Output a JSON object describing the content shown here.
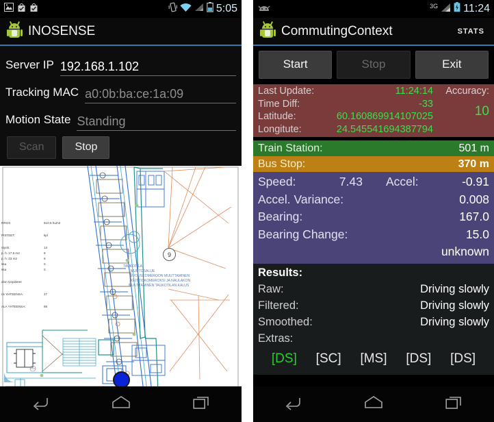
{
  "left_phone": {
    "statusbar": {
      "icons": [
        "image-icon",
        "download-complete-icon",
        "download-complete-icon"
      ],
      "right_icons": [
        "vibrate-icon",
        "wifi-icon",
        "signal-icon",
        "battery-icon"
      ],
      "clock": "5:05"
    },
    "actionbar": {
      "app_icon": "android-robot-icon",
      "title": "INOSENSE"
    },
    "form": {
      "fields": [
        {
          "label": "Server IP",
          "value": "192.168.1.102",
          "is_placeholder": false
        },
        {
          "label": "Tracking MAC",
          "value": "a0:0b:ba:ce:1a:09",
          "is_placeholder": true
        },
        {
          "label": "Motion State",
          "value": "Standing",
          "is_placeholder": true
        }
      ],
      "buttons": [
        {
          "label": "Scan",
          "enabled": false
        },
        {
          "label": "Stop",
          "enabled": true
        }
      ]
    },
    "map": {
      "name": "floor-plan",
      "marker": "current-position-blip",
      "callout_number": "9",
      "annotation_lines": [
        "TAUKOTILA",
        "MUUTOSALUE",
        "SIVOUSKOMEROON MUUTTAMINEN",
        "KEITTIOKOMEROKSI JA NAULAKON",
        "MUUTTAMINEN TAUKOTILAN KALUS"
      ],
      "legend": [
        {
          "key": "RROS",
          "value": "610.5 hum2"
        },
        {
          "key": "PISTEET:",
          "value": "kpl"
        },
        {
          "key": "otyoh.",
          "value": "13"
        },
        {
          "key": "p. h. 17,5 m2",
          "value": "8"
        },
        {
          "key": "p. h. 23 m2",
          "value": "6"
        },
        {
          "key": "ssa",
          "value": "0"
        },
        {
          "key": "ssa",
          "value": "0"
        },
        {
          "key": "alon tyopisteet",
          "value": ""
        },
        {
          "key": "ns  YHTEENSA:",
          "value": "27"
        },
        {
          "key": "ALA YHTEENSA:",
          "value": "88"
        }
      ]
    },
    "navbar": {
      "items": [
        "back-icon",
        "home-icon",
        "recents-icon"
      ]
    }
  },
  "right_phone": {
    "statusbar": {
      "left_icons": [
        "android-face-icon"
      ],
      "network": "3G",
      "right_icons": [
        "signal-icon",
        "battery-charging-icon"
      ],
      "clock": "11:24"
    },
    "actionbar": {
      "app_icon": "android-robot-icon",
      "title": "CommutingContext",
      "action_label": "STATS"
    },
    "controls": [
      {
        "label": "Start",
        "enabled": true
      },
      {
        "label": "Stop",
        "enabled": false
      },
      {
        "label": "Exit",
        "enabled": true
      }
    ],
    "gps_panel": {
      "bg_color": "#7a3b3b",
      "rows": [
        {
          "key": "Last Update:",
          "value": "11:24:14"
        },
        {
          "key": "Time Diff:",
          "value": "-33"
        },
        {
          "key": "Latitude:",
          "value": "60.160869914107025"
        },
        {
          "key": "Longitute:",
          "value": "24.545541694387794"
        }
      ],
      "accuracy_label": "Accuracy:",
      "accuracy_value": "10"
    },
    "transit": [
      {
        "key": "Train Station:",
        "value": "501 m",
        "bg_color": "#2b7a2b"
      },
      {
        "key": "Bus Stop:",
        "value": "370 m",
        "bg_color": "#bd8014"
      }
    ],
    "motion_panel": {
      "bg_color": "#4a4478",
      "speed_key": "Speed:",
      "speed_value": "7.43",
      "accel_key": "Accel:",
      "accel_value": "-0.91",
      "rows": [
        {
          "key": "Accel. Variance:",
          "value": "0.008"
        },
        {
          "key": "Bearing:",
          "value": "167.0"
        },
        {
          "key": "Bearing Change:",
          "value": "15.0"
        }
      ],
      "status": "unknown"
    },
    "results_panel": {
      "heading": "Results:",
      "rows": [
        {
          "key": "Raw:",
          "value": "Driving slowly"
        },
        {
          "key": "Filtered:",
          "value": "Driving slowly"
        },
        {
          "key": "Smoothed:",
          "value": "Driving slowly"
        }
      ],
      "extras_label": "Extras:",
      "tags": [
        {
          "label": "[DS]",
          "active": true
        },
        {
          "label": "[SC]",
          "active": false
        },
        {
          "label": "[MS]",
          "active": false
        },
        {
          "label": "[DS]",
          "active": false
        },
        {
          "label": "[DS]",
          "active": false
        }
      ]
    },
    "navbar": {
      "items": [
        "back-icon",
        "home-icon",
        "recents-icon"
      ]
    }
  }
}
